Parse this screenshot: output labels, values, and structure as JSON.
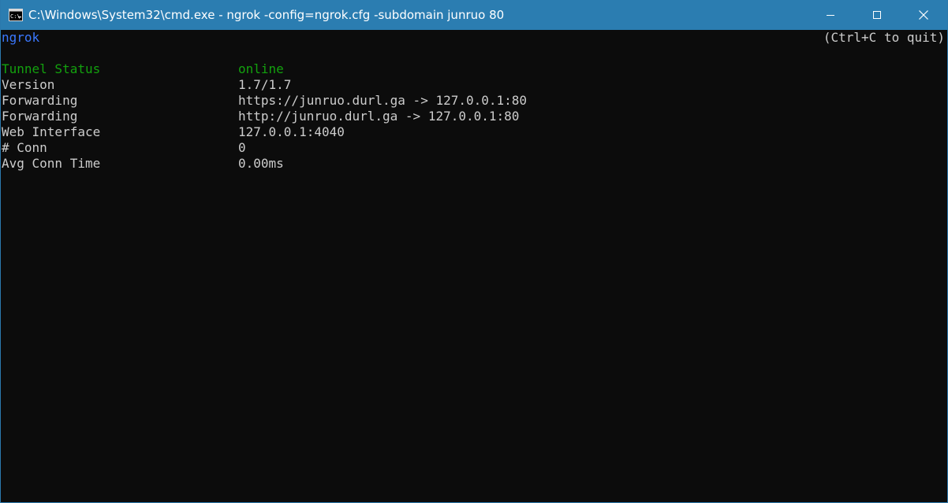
{
  "window": {
    "title": "C:\\Windows\\System32\\cmd.exe - ngrok  -config=ngrok.cfg -subdomain junruo 80",
    "icon": "cmd-console-icon",
    "accent_color": "#2b7db1"
  },
  "console": {
    "header": {
      "app_name": "ngrok",
      "quit_hint": "(Ctrl+C to quit)",
      "app_name_color": "#3b78ff"
    },
    "rows": [
      {
        "label": "Tunnel Status",
        "value": "online",
        "color": "#13a10e"
      },
      {
        "label": "Version",
        "value": "1.7/1.7"
      },
      {
        "label": "Forwarding",
        "value": "https://junruo.durl.ga -> 127.0.0.1:80"
      },
      {
        "label": "Forwarding",
        "value": "http://junruo.durl.ga -> 127.0.0.1:80"
      },
      {
        "label": "Web Interface",
        "value": "127.0.0.1:4040"
      },
      {
        "label": "# Conn",
        "value": "0"
      },
      {
        "label": "Avg Conn Time",
        "value": "0.00ms"
      }
    ]
  }
}
